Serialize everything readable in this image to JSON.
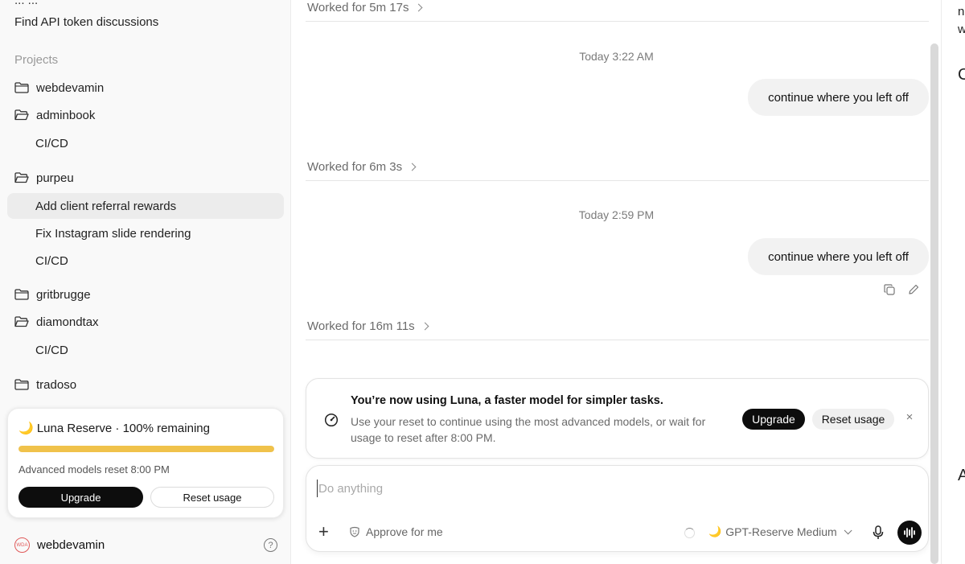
{
  "sidebar": {
    "clipped_top_label": "... ...",
    "find_item": "Find API token discussions",
    "projects_heading": "Projects",
    "items": [
      {
        "label": "webdevamin",
        "kind": "folder"
      },
      {
        "label": "adminbook",
        "kind": "folder-open"
      },
      {
        "label": "CI/CD",
        "kind": "sub"
      },
      {
        "label": "purpeu",
        "kind": "folder-open"
      },
      {
        "label": "Add client referral rewards",
        "kind": "sub",
        "active": true
      },
      {
        "label": "Fix Instagram slide rendering",
        "kind": "sub"
      },
      {
        "label": "CI/CD",
        "kind": "sub"
      },
      {
        "label": "gritbrugge",
        "kind": "folder"
      },
      {
        "label": "diamondtax",
        "kind": "folder-open"
      },
      {
        "label": "CI/CD",
        "kind": "sub"
      },
      {
        "label": "tradoso",
        "kind": "folder"
      }
    ],
    "usage": {
      "title": "🌙 Luna Reserve · 100% remaining",
      "percent_remaining": 100,
      "reset_text": "Advanced models reset 8:00 PM",
      "upgrade_label": "Upgrade",
      "reset_label": "Reset usage",
      "bar_color": "#f0c24b"
    },
    "profile": {
      "name": "webdevamin",
      "avatar_text": "WDA",
      "help_label": "?"
    }
  },
  "chat": {
    "blocks": [
      {
        "worked": "Worked for 5m 17s"
      },
      {
        "timestamp": "Today 3:22 AM",
        "message": "continue where you left off",
        "worked": "Worked for 6m 3s"
      },
      {
        "timestamp": "Today 2:59 PM",
        "message": "continue where you left off",
        "worked": "Worked for 16m 11s"
      }
    ]
  },
  "notice": {
    "title": "You’re now using Luna, a faster model for simpler tasks.",
    "body": "Use your reset to continue using the most advanced models, or wait for usage to reset after 8:00 PM.",
    "upgrade_label": "Upgrade",
    "reset_label": "Reset usage",
    "close_label": "×"
  },
  "composer": {
    "placeholder": "Do anything",
    "plus_label": "+",
    "approve_label": "Approve for me",
    "model_label": "GPT-Reserve Medium",
    "model_icon": "🌙"
  },
  "right_pane": {
    "line1": "n",
    "line2": "w",
    "big1": "C",
    "big2": "A"
  }
}
